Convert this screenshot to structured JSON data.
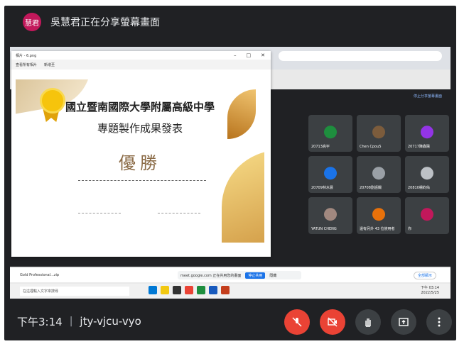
{
  "header": {
    "avatar_text": "慧君",
    "title": "吳慧君正在分享螢幕畫面"
  },
  "photo_viewer": {
    "window_title": "相片 - 6.png",
    "toolbar_left": "查看所有相片",
    "toolbar_new": "新增至",
    "certificate": {
      "school": "國立暨南國際大學附屬高級中學",
      "event": "專題製作成果發表",
      "award": "優勝"
    }
  },
  "shared_browser": {
    "stop_sharing": "停止分享螢幕畫面",
    "bookmarks": [
      "",
      "",
      "",
      ""
    ],
    "tiles": [
      {
        "name": "20713高宇"
      },
      {
        "name": "Chen Cpou5"
      },
      {
        "name": "20717陳鑫陽"
      },
      {
        "name": "20709林水晨"
      },
      {
        "name": "20708劉語嫻"
      },
      {
        "name": "20810楊鈞佑"
      },
      {
        "name": "YATUN CHENG"
      },
      {
        "name": "還有另外 43 位使用者"
      },
      {
        "name": "你"
      }
    ]
  },
  "downloads": {
    "file": "Gold Professional...zip",
    "notice": "meet.google.com 正在共用您的畫面",
    "stop_btn": "停止共用",
    "hide_btn": "隱藏",
    "show_all": "全部顯示"
  },
  "taskbar": {
    "search_placeholder": "在這裡輸入文字來搜尋",
    "clock_time": "下午 03:14",
    "clock_date": "2022/5/25"
  },
  "footer": {
    "time": "下午3:14",
    "separator": "|",
    "meeting_code": "jty-vjcu-vyo"
  },
  "colors": {
    "meet_bg": "#202124",
    "red": "#ea4335",
    "grey_btn": "#3c4043",
    "avatar": "#c2185b"
  }
}
